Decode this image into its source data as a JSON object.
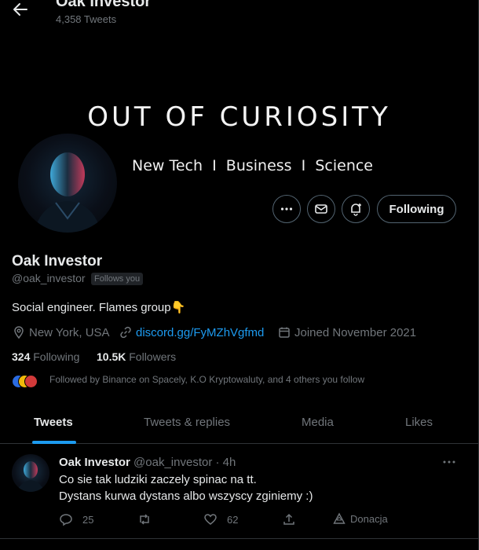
{
  "header": {
    "name": "Oak Investor",
    "tweet_count": "4,358 Tweets"
  },
  "banner": {
    "title": "OUT OF CURIOSITY",
    "subtitle": "New Tech  I  Business  I  Science"
  },
  "actions": {
    "follow_label": "Following"
  },
  "profile": {
    "name": "Oak Investor",
    "handle": "@oak_investor",
    "follows_you": "Follows you",
    "bio": "Social engineer. Flames group👇",
    "location": "New York, USA",
    "link": "discord.gg/FyMZhVgfmd",
    "joined": "Joined November 2021",
    "following_count": "324",
    "following_label": "Following",
    "followers_count": "10.5K",
    "followers_label": "Followers",
    "followed_by": "Followed by Binance on Spacely, K.O Kryptowaluty, and 4 others you follow"
  },
  "tabs": [
    "Tweets",
    "Tweets & replies",
    "Media",
    "Likes"
  ],
  "tweet": {
    "name": "Oak Investor",
    "handle": "@oak_investor",
    "time": "· 4h",
    "line1": "Co sie tak ludziki zaczely spinac na tt.",
    "line2": "Dystans kurwa dystans albo wszyscy zginiemy :)",
    "replies": "25",
    "likes": "62",
    "donation": "Donacja"
  },
  "colors": {
    "accent": "#1d9bf0",
    "muted": "#71767b",
    "text": "#e7e9ea",
    "border": "#2f3336"
  }
}
